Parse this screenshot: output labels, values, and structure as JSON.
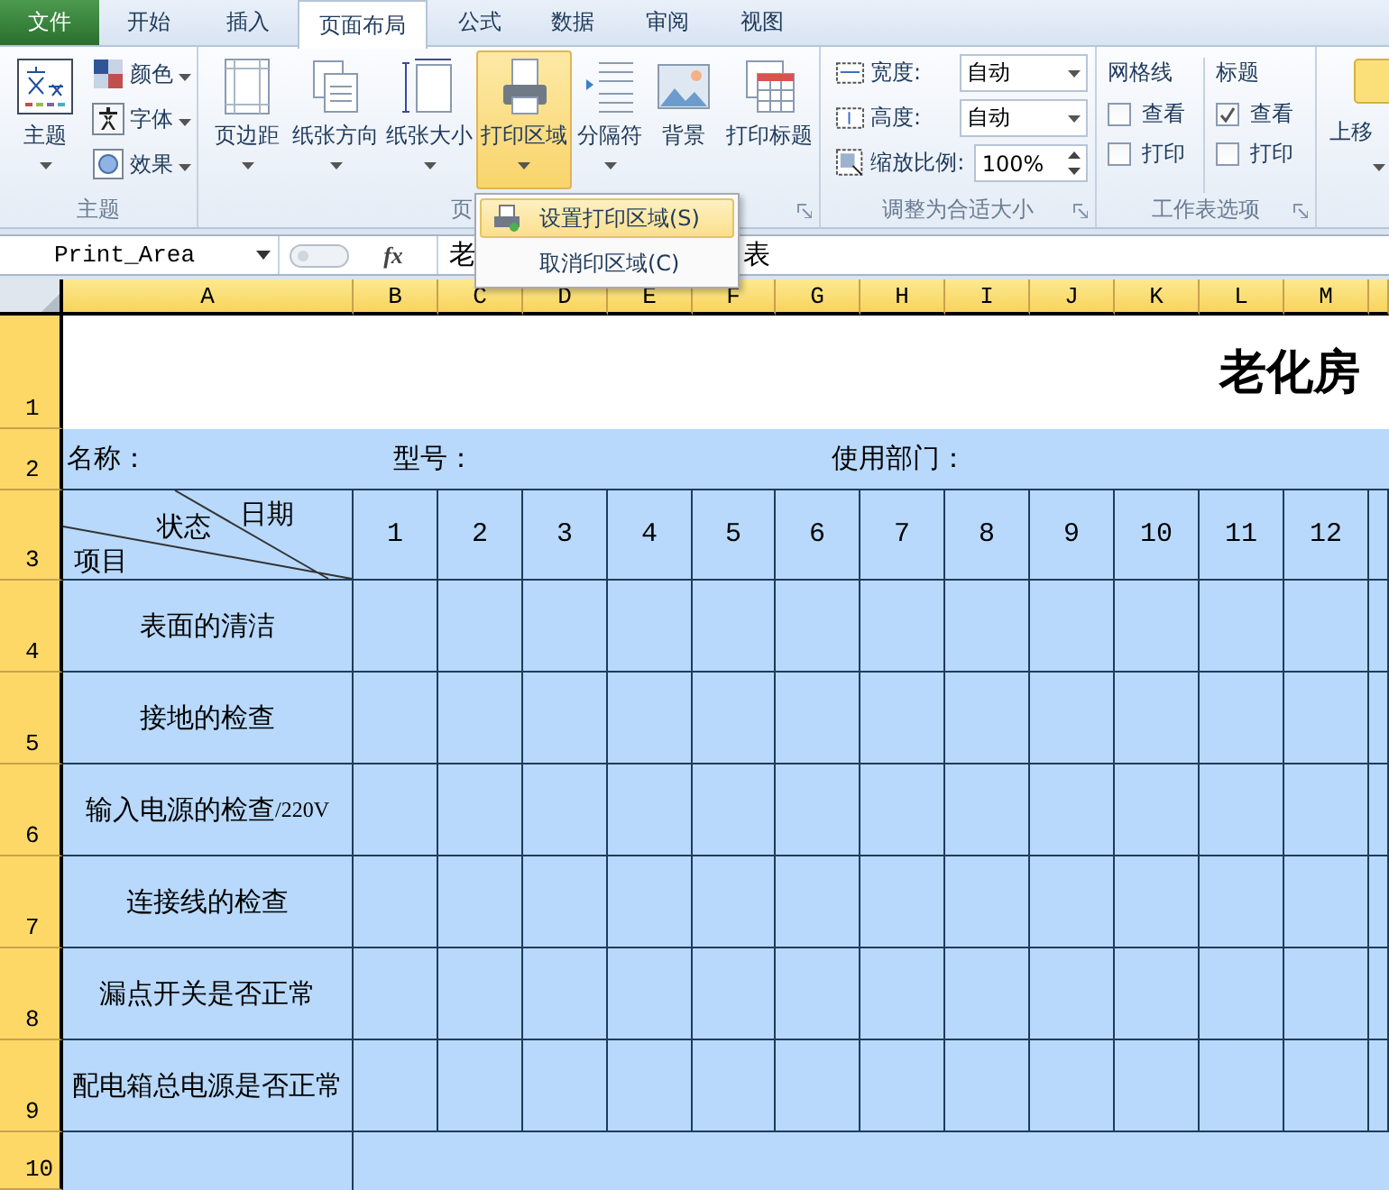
{
  "tabs": [
    {
      "label": "文件",
      "kind": "file",
      "selected": false
    },
    {
      "label": "开始",
      "kind": "tab",
      "selected": false
    },
    {
      "label": "插入",
      "kind": "tab",
      "selected": false
    },
    {
      "label": "页面布局",
      "kind": "tab",
      "selected": true
    },
    {
      "label": "公式",
      "kind": "tab",
      "selected": false
    },
    {
      "label": "数据",
      "kind": "tab",
      "selected": false
    },
    {
      "label": "审阅",
      "kind": "tab",
      "selected": false
    },
    {
      "label": "视图",
      "kind": "tab",
      "selected": false
    }
  ],
  "ribbon": {
    "themes": {
      "button": {
        "label": "主题",
        "dropdown": true
      },
      "items": [
        {
          "label": "颜色"
        },
        {
          "label": "字体"
        },
        {
          "label": "效果"
        }
      ],
      "group_label": "主题"
    },
    "page_setup": {
      "buttons": [
        {
          "label": "页边距",
          "dropdown": true,
          "pressed": false
        },
        {
          "label": "纸张方向",
          "dropdown": true,
          "pressed": false
        },
        {
          "label": "纸张大小",
          "dropdown": true,
          "pressed": false
        },
        {
          "label": "打印区域",
          "dropdown": true,
          "pressed": true
        },
        {
          "label": "分隔符",
          "dropdown": true,
          "pressed": false
        },
        {
          "label": "背景",
          "dropdown": false,
          "pressed": false
        },
        {
          "label": "打印标题",
          "dropdown": false,
          "pressed": false
        }
      ],
      "group_label": "页"
    },
    "scale": {
      "rows": [
        {
          "label": "宽度:",
          "value": "自动",
          "kind": "dropdown"
        },
        {
          "label": "高度:",
          "value": "自动",
          "kind": "dropdown"
        },
        {
          "label": "缩放比例:",
          "value": "100%",
          "kind": "spin"
        }
      ],
      "group_label": "调整为合适大小"
    },
    "sheet_options": {
      "columns": [
        {
          "heading": "网格线",
          "options": [
            {
              "label": "查看",
              "checked": false
            },
            {
              "label": "打印",
              "checked": false
            }
          ]
        },
        {
          "heading": "标题",
          "options": [
            {
              "label": "查看",
              "checked": true
            },
            {
              "label": "打印",
              "checked": false
            }
          ]
        }
      ],
      "group_label": "工作表选项"
    },
    "arrange": {
      "button": {
        "label": "上移",
        "dropdown": true
      }
    }
  },
  "menu": {
    "items": [
      {
        "label": "设置打印区域(S)",
        "selected": true
      },
      {
        "label": "取消印区域(C)",
        "selected": false
      }
    ]
  },
  "formula_bar": {
    "name_box": "Print_Area",
    "fx": "fx",
    "parts": [
      "老",
      "表"
    ]
  },
  "sheet": {
    "columns": [
      "A",
      "B",
      "C",
      "D",
      "E",
      "F",
      "G",
      "H",
      "I",
      "J",
      "K",
      "L",
      "M"
    ],
    "row_numbers": [
      "1",
      "2",
      "3",
      "4",
      "5",
      "6",
      "7",
      "8",
      "9",
      "10"
    ],
    "title": "老化房",
    "info": [
      "名称：",
      "型号：",
      "使用部门："
    ],
    "corner": {
      "top": "日期",
      "middle": "状态",
      "bottom": "项目"
    },
    "days": [
      "1",
      "2",
      "3",
      "4",
      "5",
      "6",
      "7",
      "8",
      "9",
      "10",
      "11",
      "12"
    ],
    "items": [
      {
        "label": "表面的清洁"
      },
      {
        "label": "接地的检查"
      },
      {
        "label": "输入电源的检查",
        "note": "/220V"
      },
      {
        "label": "连接线的检查"
      },
      {
        "label": "漏点开关是否正常"
      },
      {
        "label": "配电箱总电源是否正常"
      }
    ]
  }
}
